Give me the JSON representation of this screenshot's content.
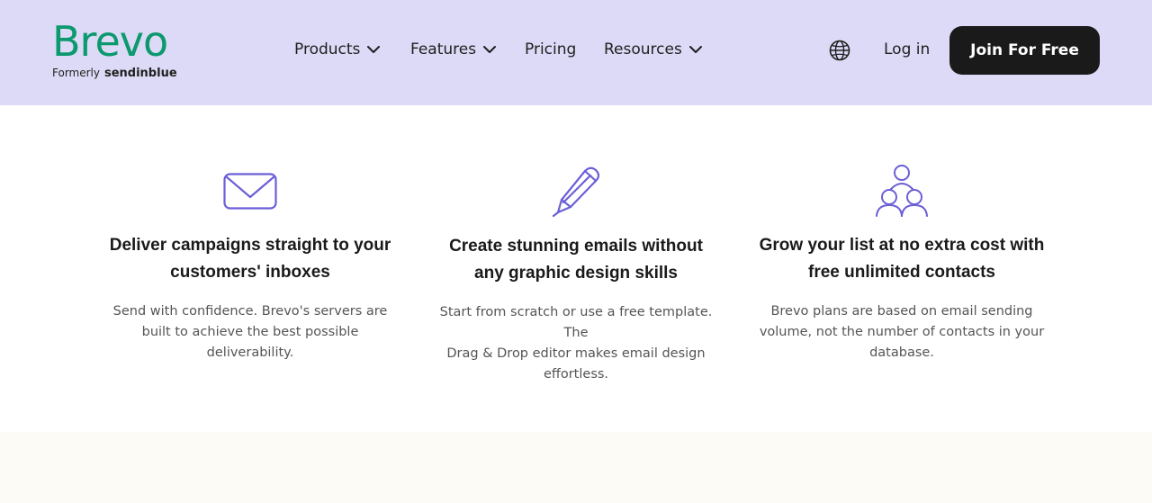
{
  "header": {
    "logo": {
      "name": "Brevo",
      "formerly": "Formerly",
      "former_brand": "sendinblue"
    },
    "nav": [
      {
        "label": "Products",
        "has_dropdown": true
      },
      {
        "label": "Features",
        "has_dropdown": true
      },
      {
        "label": "Pricing",
        "has_dropdown": false
      },
      {
        "label": "Resources",
        "has_dropdown": true
      }
    ],
    "language_icon": "globe-icon",
    "login_label": "Log in",
    "cta_label": "Join For Free"
  },
  "features": [
    {
      "icon": "envelope-icon",
      "title_line1": "Deliver campaigns straight to your",
      "title_line2": "customers' inboxes",
      "desc_line1": "Send with confidence. Brevo's servers are",
      "desc_line2": "built to achieve the best possible",
      "desc_line3": "deliverability."
    },
    {
      "icon": "pencil-icon",
      "title_line1": "Create stunning emails without",
      "title_line2": "any graphic design skills",
      "desc_line1": "Start from scratch or use a free template. The",
      "desc_line2": "Drag & Drop editor makes email design",
      "desc_line3": "effortless."
    },
    {
      "icon": "contacts-icon",
      "title_line1": "Grow your list at no extra cost with",
      "title_line2": "free unlimited contacts",
      "desc_line1": "Brevo plans are based on email sending",
      "desc_line2": "volume, not the number of contacts in your",
      "desc_line3": "database."
    }
  ],
  "colors": {
    "header_bg": "#dcdaf6",
    "brand_green": "#0b996e",
    "icon_purple": "#6b5fd6",
    "cta_bg": "#1a1a1a",
    "bottom_band": "#fcfbf6"
  }
}
